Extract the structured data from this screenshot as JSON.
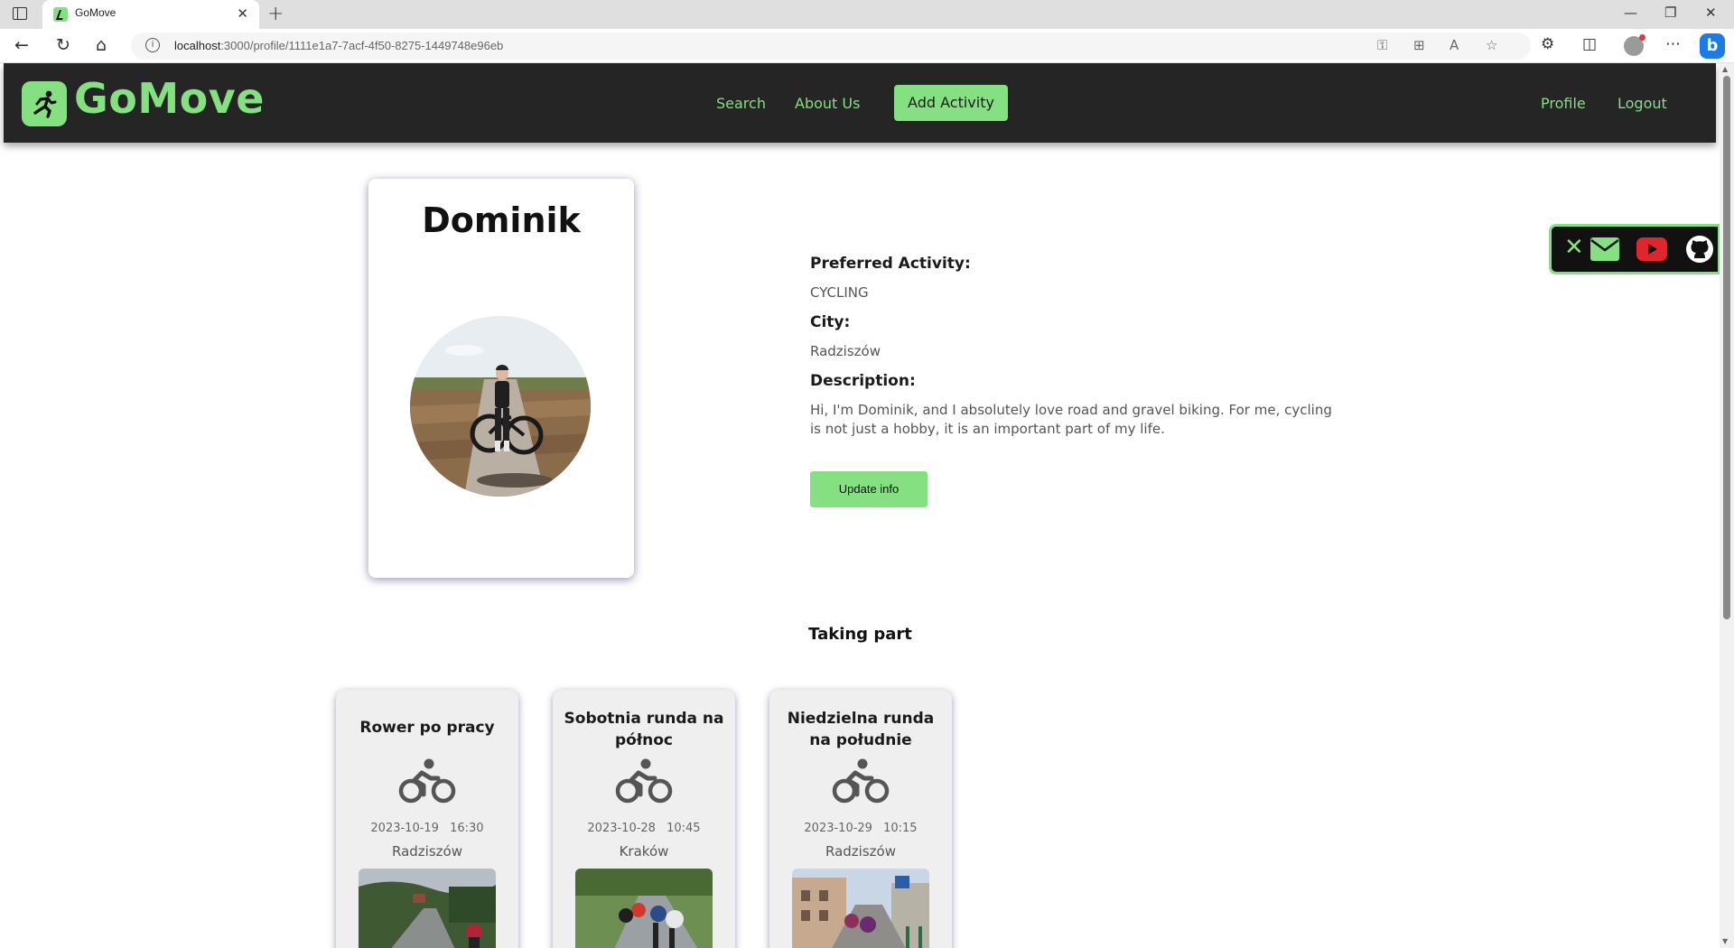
{
  "browser": {
    "tab_title": "GoMove",
    "url_host": "localhost",
    "url_rest": ":3000/profile/1111e1a7-7acf-4f50-8275-1449748e96eb"
  },
  "header": {
    "logo_text": "GoMove",
    "nav": {
      "search": "Search",
      "about": "About Us",
      "add_activity": "Add Activity",
      "profile": "Profile",
      "logout": "Logout"
    },
    "accent_color": "#84e081"
  },
  "social": {
    "icons": [
      "x-icon",
      "mail-icon",
      "youtube-icon",
      "github-icon"
    ],
    "x_glyph": "✕"
  },
  "profile": {
    "name": "Dominik",
    "preferred_activity_label": "Preferred Activity:",
    "preferred_activity": "CYCLING",
    "city_label": "City:",
    "city": "Radziszów",
    "description_label": "Description:",
    "description": "Hi, I'm Dominik, and I absolutely love road and gravel biking. For me, cycling is not just a hobby, it is an important part of my life.",
    "update_button": "Update info"
  },
  "taking_part": {
    "title": "Taking part",
    "events": [
      {
        "title": "Rower po pracy",
        "date": "2023-10-19",
        "time": "16:30",
        "city": "Radziszów",
        "icon": "cycling-icon"
      },
      {
        "title": "Sobotnia runda na północ",
        "date": "2023-10-28",
        "time": "10:45",
        "city": "Kraków",
        "icon": "cycling-icon"
      },
      {
        "title": "Niedzielna runda na południe",
        "date": "2023-10-29",
        "time": "10:15",
        "city": "Radziszów",
        "icon": "cycling-icon"
      }
    ]
  }
}
